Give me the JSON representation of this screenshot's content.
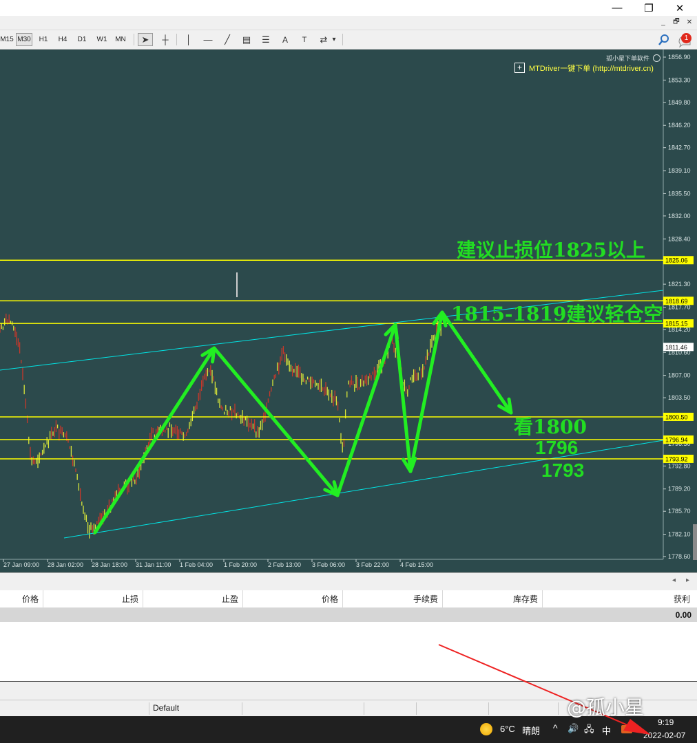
{
  "window": {
    "minimize_glyph": "—",
    "restore_glyph": "❐",
    "close_glyph": "✕",
    "mdi_min": "_",
    "mdi_restore": "🗗",
    "mdi_close": "✕"
  },
  "toolbar": {
    "timeframes": [
      "M15",
      "M30",
      "H1",
      "H4",
      "D1",
      "W1",
      "MN"
    ],
    "active_timeframe": "M30",
    "tools": [
      {
        "icon": "cursor-icon",
        "glyph": "➤"
      },
      {
        "icon": "crosshair-icon",
        "glyph": "┼"
      },
      {
        "icon": "vertical-line-icon",
        "glyph": "│"
      },
      {
        "icon": "horizontal-line-icon",
        "glyph": "—"
      },
      {
        "icon": "trendline-icon",
        "glyph": "╱"
      },
      {
        "icon": "channel-icon",
        "glyph": "▤"
      },
      {
        "icon": "fibonacci-icon",
        "glyph": "☰"
      },
      {
        "icon": "text-icon",
        "glyph": "A"
      },
      {
        "icon": "text-label-icon",
        "glyph": "T"
      },
      {
        "icon": "arrows-icon",
        "glyph": "⇄"
      },
      {
        "icon": "dropdown-icon",
        "glyph": "▾"
      }
    ],
    "search_icon": "search-icon",
    "notification_count": "1"
  },
  "chart": {
    "watermark": "孤小星下单软件",
    "plugin_plus": "+",
    "plugin_label": "MTDriver一键下单 (http://mtdriver.cn)",
    "price_labels": [
      "1856.90",
      "1853.30",
      "1849.80",
      "1846.20",
      "1842.70",
      "1839.10",
      "1835.50",
      "1832.00",
      "1828.40",
      "1821.30",
      "1817.70",
      "1814.20",
      "1810.60",
      "1807.00",
      "1803.50",
      "1796.30",
      "1792.80",
      "1789.20",
      "1785.70",
      "1782.10",
      "1778.60"
    ],
    "hline_labels": [
      "1825.06",
      "1818.69",
      "1815.15",
      "1800.50",
      "1796.94",
      "1793.92"
    ],
    "current_price": "1811.46",
    "time_labels": [
      "27 Jan 09:00",
      "28 Jan 02:00",
      "28 Jan 18:00",
      "31 Jan 11:00",
      "1 Feb 04:00",
      "1 Feb 20:00",
      "2 Feb 13:00",
      "3 Feb 06:00",
      "3 Feb 22:00",
      "4 Feb 15:00"
    ],
    "annotations": {
      "stop": "建议止损位1825以上",
      "entry": "1815-1819建议轻仓空",
      "target1": "看1800",
      "target2": "1796",
      "target3": "1793"
    },
    "colors": {
      "background": "#2c4a4c",
      "hline": "#ffff00",
      "trend": "#00e5e5",
      "arrow": "#22ee22",
      "annot": "#22dd22"
    }
  },
  "table": {
    "headers": [
      "价格",
      "止损",
      "止盈",
      "价格",
      "手续费",
      "库存费",
      "获利"
    ],
    "total_profit": "0.00"
  },
  "statusbar": {
    "profile": "Default"
  },
  "taskbar": {
    "weather_temp": "6°C",
    "weather_desc": "晴朗",
    "ime": "中",
    "time": "9:19",
    "date": "2022-02-07",
    "watermark": "@孤小星",
    "chevron": "^",
    "volume_glyph": "🔊",
    "network_glyph": "🖧"
  }
}
